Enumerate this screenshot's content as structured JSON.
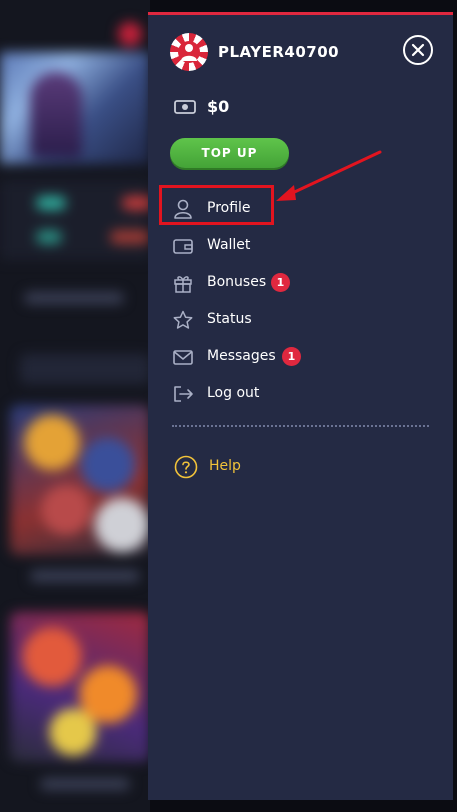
{
  "user": {
    "username": "PLAYER40700",
    "balance": "$0"
  },
  "actions": {
    "top_up_label": "TOP UP"
  },
  "menu": {
    "items": [
      {
        "label": "Profile",
        "icon": "user-icon"
      },
      {
        "label": "Wallet",
        "icon": "wallet-icon"
      },
      {
        "label": "Bonuses",
        "icon": "gift-icon",
        "badge": "1"
      },
      {
        "label": "Status",
        "icon": "star-icon"
      },
      {
        "label": "Messages",
        "icon": "envelope-icon",
        "badge": "1"
      },
      {
        "label": "Log out",
        "icon": "logout-icon"
      }
    ],
    "help_label": "Help"
  },
  "colors": {
    "menu_bg": "#242a44",
    "accent_red": "#e0283f",
    "topup_green": "#4fb03f",
    "help_yellow": "#f2c33a"
  }
}
